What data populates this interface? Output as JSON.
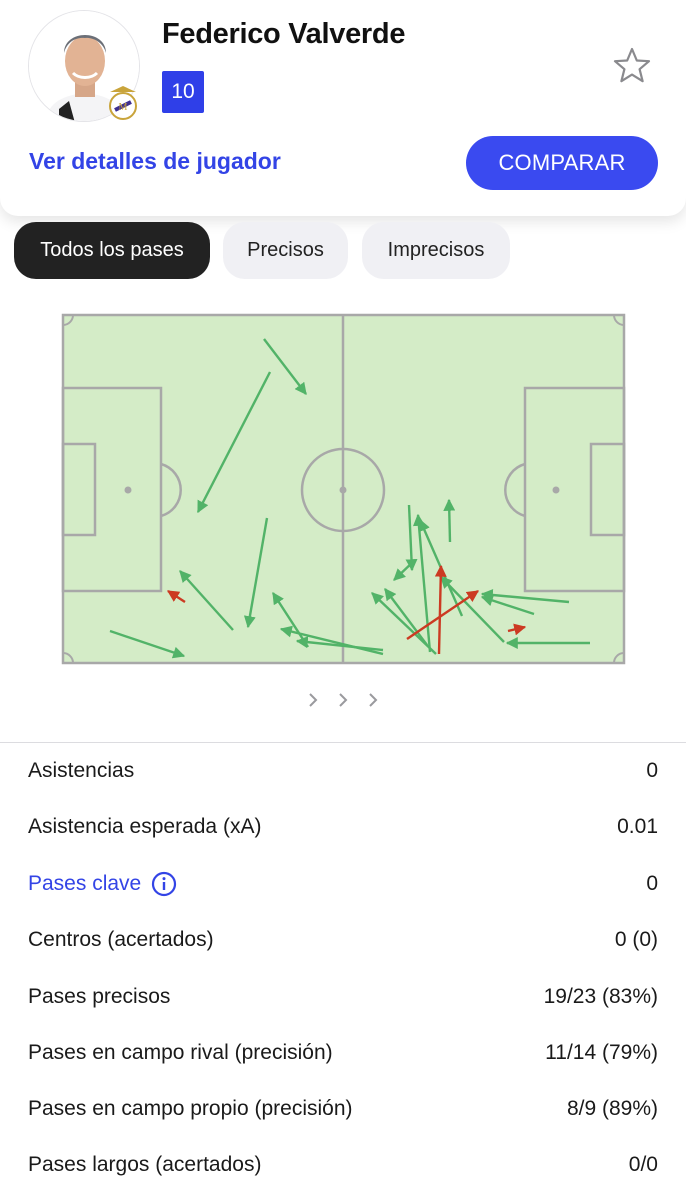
{
  "player": {
    "name": "Federico Valverde",
    "number": "10",
    "avatar_icon": "player-photo",
    "club_icon": "real-madrid-crest"
  },
  "actions": {
    "details_link": "Ver detalles de jugador",
    "compare_button": "COMPARAR",
    "favorite_icon": "star-outline-icon"
  },
  "tabs": [
    {
      "label": "Todos los pases",
      "active": true
    },
    {
      "label": "Precisos",
      "active": false
    },
    {
      "label": "Imprecisos",
      "active": false
    }
  ],
  "pass_map": {
    "pitch_color": "#d4ecc7",
    "line_color": "#a8a8a8",
    "accurate_color": "#52b368",
    "inaccurate_color": "#cc3a22",
    "accurate_count": 19,
    "inaccurate_count": 4
  },
  "pager_icon": "chevron-right-icon",
  "stats": [
    {
      "label": "Asistencias",
      "value": "0",
      "link": false
    },
    {
      "label": "Asistencia esperada (xA)",
      "value": "0.01",
      "link": false
    },
    {
      "label": "Pases clave",
      "value": "0",
      "link": true,
      "icon": "info-icon"
    },
    {
      "label": "Centros (acertados)",
      "value": "0 (0)",
      "link": false
    },
    {
      "label": "Pases precisos",
      "value": "19/23 (83%)",
      "link": false
    },
    {
      "label": "Pases en campo rival (precisión)",
      "value": "11/14 (79%)",
      "link": false
    },
    {
      "label": "Pases en campo propio (precisión)",
      "value": "8/9 (89%)",
      "link": false
    },
    {
      "label": "Pases largos (acertados)",
      "value": "0/0",
      "link": false
    }
  ]
}
